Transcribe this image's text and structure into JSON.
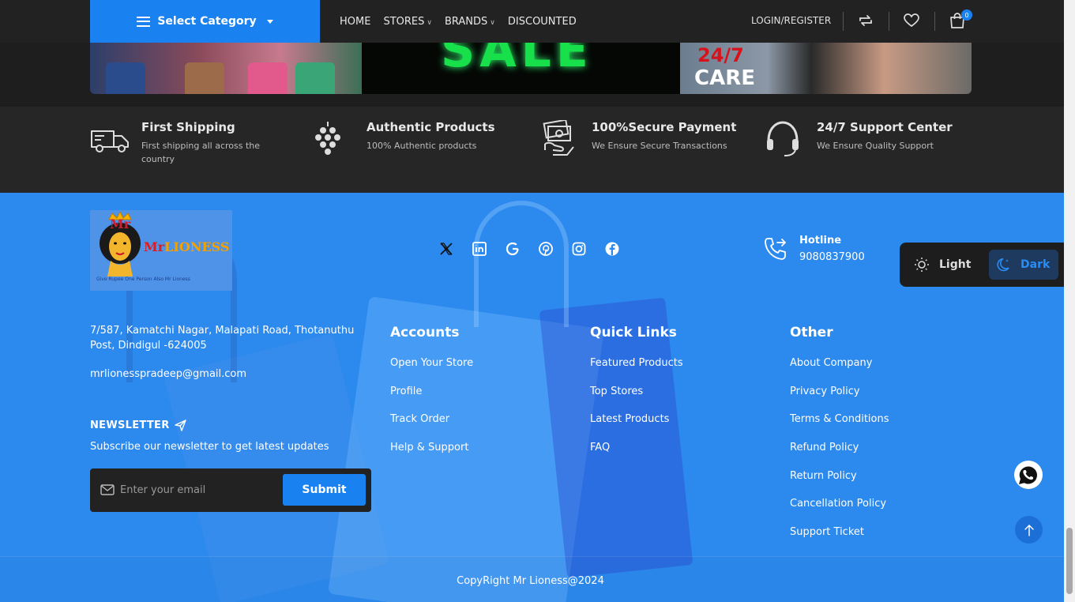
{
  "nav": {
    "category_label": "Select Category",
    "menu": [
      {
        "label": "HOME",
        "dropdown": false
      },
      {
        "label": "STORES",
        "dropdown": true
      },
      {
        "label": "BRANDS",
        "dropdown": true
      },
      {
        "label": "DISCOUNTED",
        "dropdown": false
      }
    ],
    "login_label": "LOGIN/REGISTER",
    "cart_count": "0",
    "icons": [
      "compare-icon",
      "heart-icon",
      "cart-icon"
    ]
  },
  "banners": {
    "care_number": "24/7",
    "care_word": "CARE",
    "sale_word": "SALE"
  },
  "features": [
    {
      "title": "First Shipping",
      "desc": "First shipping all across the country",
      "icon": "truck-icon"
    },
    {
      "title": "Authentic Products",
      "desc": "100% Authentic products",
      "icon": "grapes-icon"
    },
    {
      "title": "100%Secure Payment",
      "desc": "We Ensure Secure Transactions",
      "icon": "money-hand-icon"
    },
    {
      "title": "24/7 Support Center",
      "desc": "We Ensure Quality Support",
      "icon": "headset-icon"
    }
  ],
  "footer": {
    "logo": {
      "mr": "Mr",
      "brand_a": "Mr",
      "brand_b": "LIONESS",
      "tagline": "Give Rupee One Person Also Mr Lioness"
    },
    "socials": [
      "x-icon",
      "linkedin-icon",
      "google-icon",
      "pinterest-icon",
      "instagram-icon",
      "facebook-icon"
    ],
    "hotline_label": "Hotline",
    "hotline_number": "9080837900",
    "address": "7/587, Kamatchi Nagar, Malapati Road, Thotanuthu Post, Dindigul -624005",
    "email": "mrlionesspradeep@gmail.com",
    "newsletter_title": "NEWSLETTER",
    "newsletter_sub": "Subscribe our newsletter to get latest updates",
    "newsletter_placeholder": "Enter your email",
    "newsletter_submit": "Submit",
    "columns": [
      {
        "title": "Accounts",
        "links": [
          "Open Your Store",
          "Profile",
          "Track Order",
          "Help & Support"
        ]
      },
      {
        "title": "Quick Links",
        "links": [
          "Featured Products",
          "Top Stores",
          "Latest Products",
          "FAQ"
        ]
      },
      {
        "title": "Other",
        "links": [
          "About Company",
          "Privacy Policy",
          "Terms & Conditions",
          "Refund Policy",
          "Return Policy",
          "Cancellation Policy",
          "Support Ticket"
        ]
      }
    ],
    "copyright": "CopyRight Mr Lioness@2024"
  },
  "theme": {
    "light_label": "Light",
    "dark_label": "Dark",
    "active": "Dark"
  },
  "colors": {
    "accent": "#1a82f0",
    "footer_bg": "#2c89ee",
    "nav_bg": "#222222"
  }
}
